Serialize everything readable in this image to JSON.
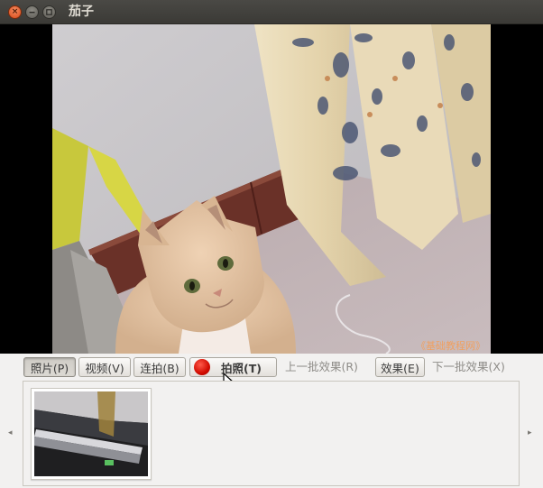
{
  "window": {
    "title": "茄子",
    "close_glyph": "×"
  },
  "viewport": {
    "watermark": "《基础教程网》"
  },
  "toolbar": {
    "photo_label": "照片(P)",
    "video_label": "视频(V)",
    "burst_label": "连拍(B)",
    "take_photo_label": "拍照(T)",
    "prev_effects_label": "上一批效果(R)",
    "effects_label": "效果(E)",
    "next_effects_label": "下一批效果(X)",
    "record_color": "#e0160a"
  },
  "strip": {
    "left_arrow": "◂",
    "right_arrow": "▸"
  },
  "icons": [
    "close-icon",
    "minimize-icon",
    "maximize-icon",
    "record-icon",
    "mouse-cursor-icon",
    "scroll-left-icon",
    "scroll-right-icon"
  ]
}
